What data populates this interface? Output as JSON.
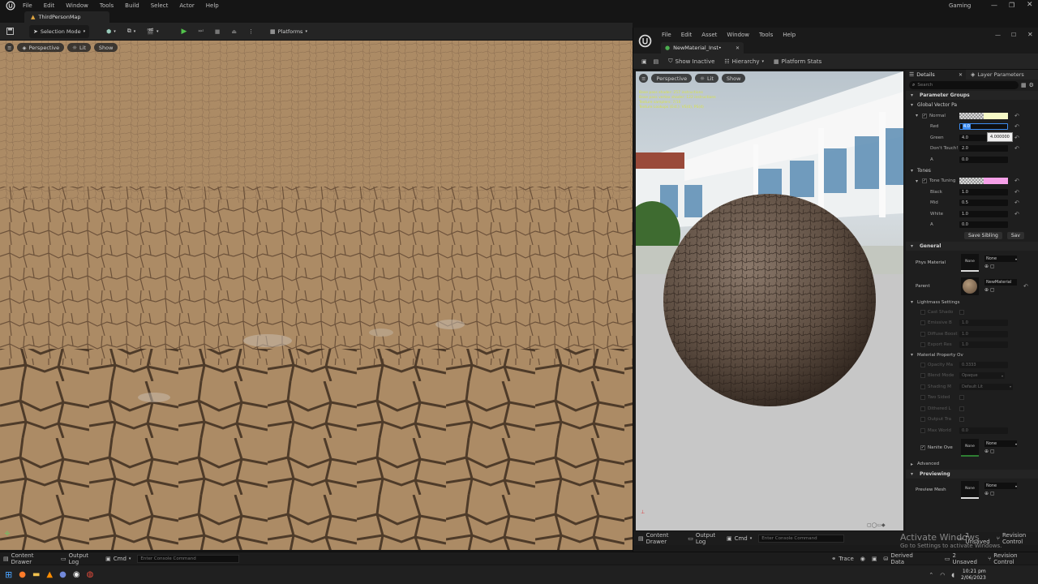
{
  "main_window": {
    "menu": [
      "File",
      "Edit",
      "Window",
      "Tools",
      "Build",
      "Select",
      "Actor",
      "Help"
    ],
    "title_right": "Gaming",
    "tab": "ThirdPersonMap",
    "toolbar": {
      "mode": "Selection Mode",
      "platforms": "Platforms"
    },
    "viewport": {
      "perspective": "Perspective",
      "lit": "Lit",
      "show": "Show"
    },
    "status": {
      "content_drawer": "Content Drawer",
      "output_log": "Output Log",
      "cmd": "Cmd",
      "console_placeholder": "Enter Console Command",
      "trace": "Trace",
      "derived_data": "Derived Data",
      "unsaved": "2 Unsaved",
      "revision_control": "Revision Control"
    }
  },
  "material_editor": {
    "menu": [
      "File",
      "Edit",
      "Asset",
      "Window",
      "Tools",
      "Help"
    ],
    "tab": "NewMaterial_Inst•",
    "toolbar": {
      "show_inactive": "Show Inactive",
      "hierarchy": "Hierarchy",
      "platform_stats": "Platform Stats"
    },
    "viewport": {
      "perspective": "Perspective",
      "lit": "Lit",
      "show": "Show",
      "stats": [
        "Base pass shader: 257 instructions",
        "Base pass vertex shader: 122 instructions",
        "Texture samplers: 7/16",
        "Texture Lookups (Est.): VS(0), PS(4)"
      ]
    },
    "details": {
      "tab_details": "Details",
      "tab_layer": "Layer Parameters",
      "search_placeholder": "Search",
      "parameter_groups": "Parameter Groups",
      "global_vector": "Global Vector Pa",
      "normal": "Normal",
      "normal_rows": [
        {
          "label": "Red",
          "value": "4.0"
        },
        {
          "label": "Green",
          "value": "4.0"
        },
        {
          "label": "Don't Touch!",
          "value": "2.0"
        },
        {
          "label": "A",
          "value": "0.0"
        }
      ],
      "tooltip_value": "4.000000",
      "tones": "Tones",
      "tone_tuning": "Tone Tuning",
      "tone_rows": [
        {
          "label": "Black",
          "value": "1.0"
        },
        {
          "label": "Mid",
          "value": "0.5"
        },
        {
          "label": "White",
          "value": "1.0"
        },
        {
          "label": "A",
          "value": "0.0"
        }
      ],
      "save_sibling": "Save Sibling",
      "save_child": "Sav",
      "general": "General",
      "phys_material": "Phys Material",
      "phys_value": "None",
      "phys_thumb": "None",
      "parent": "Parent",
      "parent_value": "NewMaterial",
      "lightmass": "Lightmass Settings",
      "lightmass_rows": [
        {
          "label": "Cast Shado",
          "value": ""
        },
        {
          "label": "Emissive B",
          "value": "1.0"
        },
        {
          "label": "Diffuse Boost",
          "value": "1.0"
        },
        {
          "label": "Export Res",
          "value": "1.0"
        }
      ],
      "material_property": "Material Property Ov",
      "mp_rows": [
        {
          "label": "Opacity Ma",
          "value": "0.3333"
        },
        {
          "label": "Blend Mode",
          "value": "Opaque"
        },
        {
          "label": "Shading M",
          "value": "Default Lit"
        },
        {
          "label": "Two Sided",
          "value": ""
        },
        {
          "label": "Dithered L",
          "value": ""
        },
        {
          "label": "Output Tra",
          "value": ""
        },
        {
          "label": "Max World",
          "value": "0.0"
        }
      ],
      "nanite_label": "Nanite Ove",
      "nanite_value": "None",
      "nanite_thumb": "None",
      "advanced": "Advanced",
      "previewing": "Previewing",
      "preview_mesh": "Preview Mesh",
      "preview_value": "None",
      "preview_thumb": "None"
    },
    "status": {
      "content_drawer": "Content Drawer",
      "output_log": "Output Log",
      "cmd": "Cmd",
      "console_placeholder": "Enter Console Command",
      "unsaved": "2 Unsaved",
      "revision_control": "Revision Control"
    }
  },
  "watermark": {
    "line1": "Activate Windows",
    "line2": "Go to Settings to activate Windows."
  },
  "taskbar": {
    "time": "10:21 pm",
    "date": "2/06/2023"
  },
  "colors": {
    "normal_swatch": "#f6f9c6",
    "tone_swatch": "#f6a0e8",
    "accent": "#3d8cf0"
  }
}
